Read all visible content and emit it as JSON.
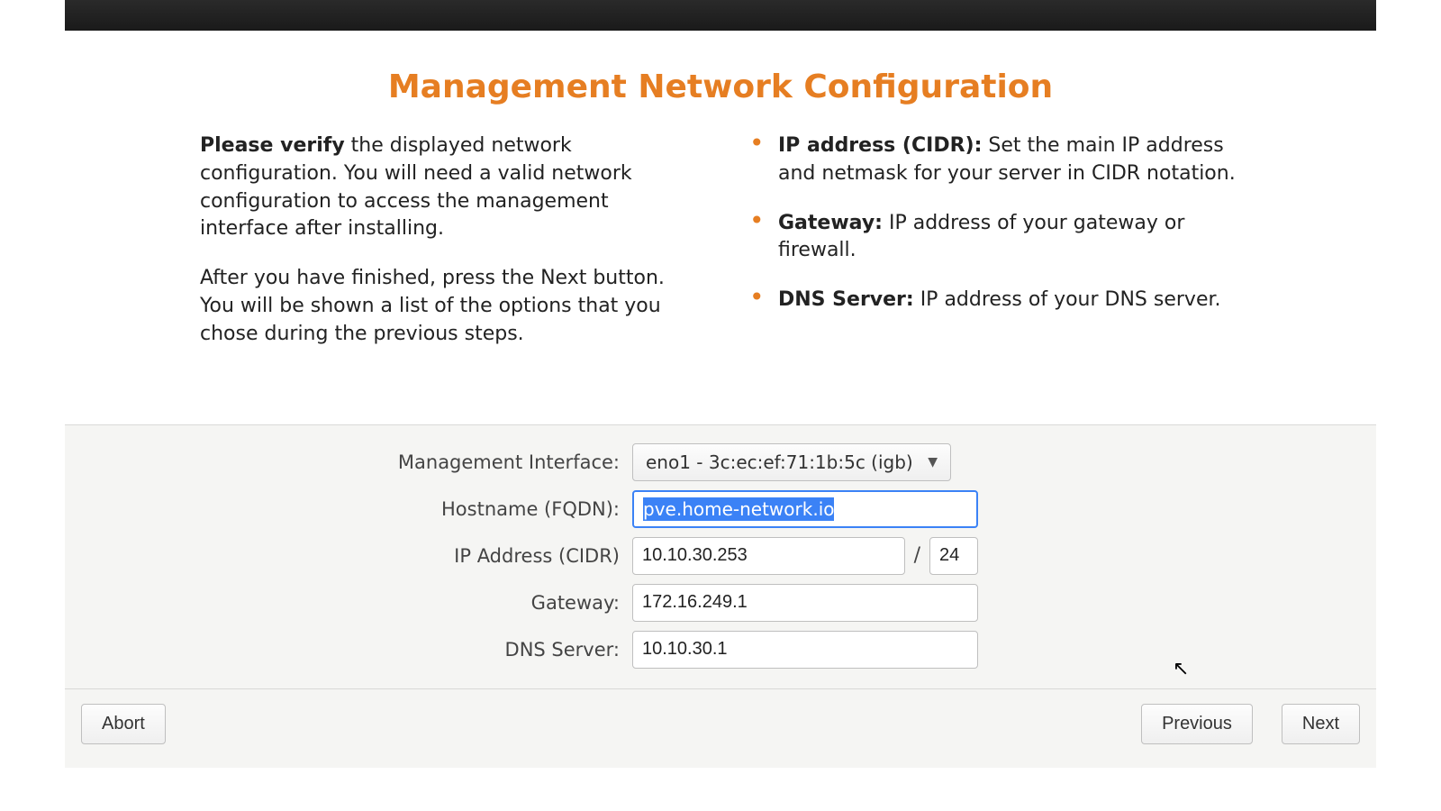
{
  "title": "Management Network Configuration",
  "intro": {
    "verify_bold": "Please verify",
    "verify_text": " the displayed network configuration. You will need a valid network configuration to access the management interface after installing.",
    "next_text": "After you have finished, press the Next button. You will be shown a list of the options that you chose during the previous steps."
  },
  "bullets": {
    "ip_bold": "IP address (CIDR):",
    "ip_text": " Set the main IP address and netmask for your server in CIDR notation.",
    "gw_bold": "Gateway:",
    "gw_text": " IP address of your gateway or firewall.",
    "dns_bold": "DNS Server:",
    "dns_text": " IP address of your DNS server."
  },
  "form": {
    "mgmt_label": "Management Interface:",
    "mgmt_value": "eno1 - 3c:ec:ef:71:1b:5c (igb)",
    "hostname_label": "Hostname (FQDN):",
    "hostname_value": "pve.home-network.io",
    "ip_label": "IP Address (CIDR)",
    "ip_value": "10.10.30.253",
    "cidr_value": "24",
    "slash": "/",
    "gateway_label": "Gateway:",
    "gateway_value": "172.16.249.1",
    "dns_label": "DNS Server:",
    "dns_value": "10.10.30.1"
  },
  "buttons": {
    "abort": "Abort",
    "previous": "Previous",
    "next": "Next"
  }
}
